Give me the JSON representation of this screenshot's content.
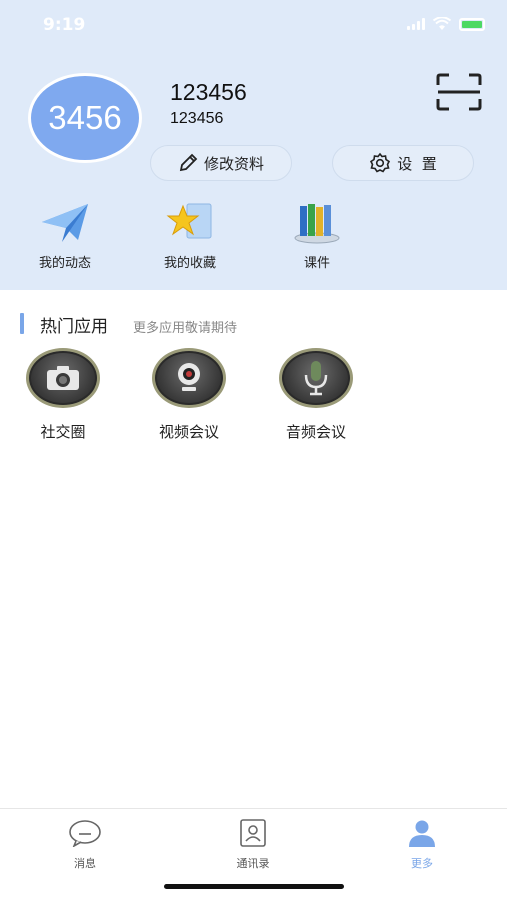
{
  "status_bar": {
    "time": "9:19"
  },
  "profile": {
    "avatar_text": "3456",
    "name": "123456",
    "id": "123456",
    "edit_label": "修改资料",
    "settings_label": "设  置"
  },
  "quick_links": [
    {
      "label": "我的动态",
      "icon": "paper-plane-icon"
    },
    {
      "label": "我的收藏",
      "icon": "star-icon"
    },
    {
      "label": "课件",
      "icon": "books-icon"
    }
  ],
  "section": {
    "title": "热门应用",
    "subtitle": "更多应用敬请期待"
  },
  "apps": [
    {
      "label": "社交圈",
      "icon": "camera-icon"
    },
    {
      "label": "视频会议",
      "icon": "webcam-icon"
    },
    {
      "label": "音频会议",
      "icon": "microphone-icon"
    }
  ],
  "tabbar": {
    "items": [
      {
        "label": "消息",
        "icon": "chat-icon"
      },
      {
        "label": "通讯录",
        "icon": "contacts-icon"
      },
      {
        "label": "更多",
        "icon": "user-icon",
        "active": true
      }
    ]
  },
  "colors": {
    "header_bg": "#dfeaf9",
    "accent": "#7aa6e8",
    "avatar_bg": "#7fa9ef"
  }
}
